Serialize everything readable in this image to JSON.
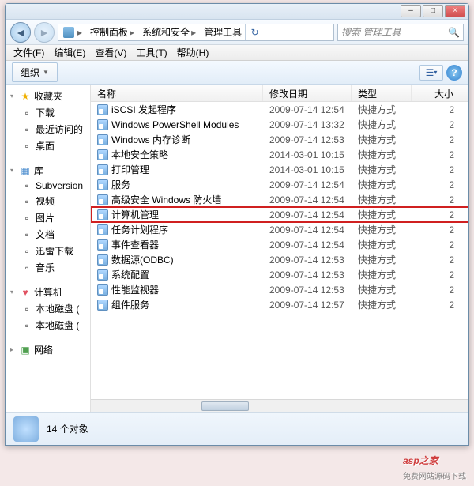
{
  "window": {
    "breadcrumb": [
      "控制面板",
      "系统和安全",
      "管理工具"
    ],
    "search_placeholder": "搜索 管理工具"
  },
  "menus": [
    {
      "label": "文件(F)"
    },
    {
      "label": "编辑(E)"
    },
    {
      "label": "查看(V)"
    },
    {
      "label": "工具(T)"
    },
    {
      "label": "帮助(H)"
    }
  ],
  "toolbar": {
    "organize": "组织"
  },
  "sidebar": {
    "favorites": {
      "label": "收藏夹",
      "items": [
        "下载",
        "最近访问的",
        "桌面"
      ]
    },
    "libraries": {
      "label": "库",
      "items": [
        "Subversion",
        "视频",
        "图片",
        "文档",
        "迅雷下载",
        "音乐"
      ]
    },
    "computer": {
      "label": "计算机",
      "items": [
        "本地磁盘 (",
        "本地磁盘 ("
      ]
    },
    "network": {
      "label": "网络"
    }
  },
  "columns": {
    "name": "名称",
    "date": "修改日期",
    "type": "类型",
    "size": "大小"
  },
  "files": [
    {
      "name": "iSCSI 发起程序",
      "date": "2009-07-14 12:54",
      "type": "快捷方式",
      "size": "2"
    },
    {
      "name": "Windows PowerShell Modules",
      "date": "2009-07-14 13:32",
      "type": "快捷方式",
      "size": "2"
    },
    {
      "name": "Windows 内存诊断",
      "date": "2009-07-14 12:53",
      "type": "快捷方式",
      "size": "2"
    },
    {
      "name": "本地安全策略",
      "date": "2014-03-01 10:15",
      "type": "快捷方式",
      "size": "2"
    },
    {
      "name": "打印管理",
      "date": "2014-03-01 10:15",
      "type": "快捷方式",
      "size": "2"
    },
    {
      "name": "服务",
      "date": "2009-07-14 12:54",
      "type": "快捷方式",
      "size": "2"
    },
    {
      "name": "高级安全 Windows 防火墙",
      "date": "2009-07-14 12:54",
      "type": "快捷方式",
      "size": "2"
    },
    {
      "name": "计算机管理",
      "date": "2009-07-14 12:54",
      "type": "快捷方式",
      "size": "2",
      "highlight": true
    },
    {
      "name": "任务计划程序",
      "date": "2009-07-14 12:54",
      "type": "快捷方式",
      "size": "2"
    },
    {
      "name": "事件查看器",
      "date": "2009-07-14 12:54",
      "type": "快捷方式",
      "size": "2"
    },
    {
      "name": "数据源(ODBC)",
      "date": "2009-07-14 12:53",
      "type": "快捷方式",
      "size": "2"
    },
    {
      "name": "系统配置",
      "date": "2009-07-14 12:53",
      "type": "快捷方式",
      "size": "2"
    },
    {
      "name": "性能监视器",
      "date": "2009-07-14 12:53",
      "type": "快捷方式",
      "size": "2"
    },
    {
      "name": "组件服务",
      "date": "2009-07-14 12:57",
      "type": "快捷方式",
      "size": "2"
    }
  ],
  "status": {
    "count": "14 个对象"
  },
  "watermark": {
    "main": "asp之家",
    "sub": "免费网站源码下载"
  }
}
